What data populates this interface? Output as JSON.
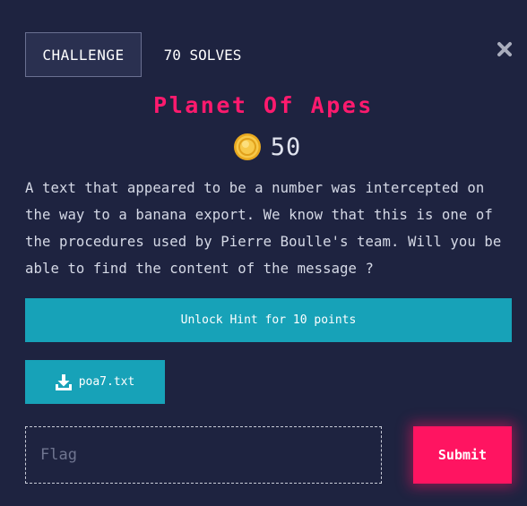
{
  "header": {
    "tab_challenge": "CHALLENGE",
    "tab_solves": "70 SOLVES",
    "close_icon": "close-icon"
  },
  "challenge": {
    "title": "Planet Of Apes",
    "points": "50",
    "points_icon": "coin-icon",
    "description": "A text that appeared to be a number was intercepted on the way to a banana export. We know that this is one of the procedures used by Pierre Boulle's team. Will you be able to find the content of the message ?"
  },
  "hint": {
    "label": "Unlock Hint for 10 points"
  },
  "file": {
    "name": "poa7.txt",
    "icon": "download-icon"
  },
  "flag": {
    "placeholder": "Flag",
    "value": ""
  },
  "submit": {
    "label": "Submit"
  },
  "colors": {
    "background": "#1e2340",
    "accent_pink": "#ff1461",
    "accent_teal": "#17a2b8",
    "coin_gold": "#f5c53a"
  }
}
